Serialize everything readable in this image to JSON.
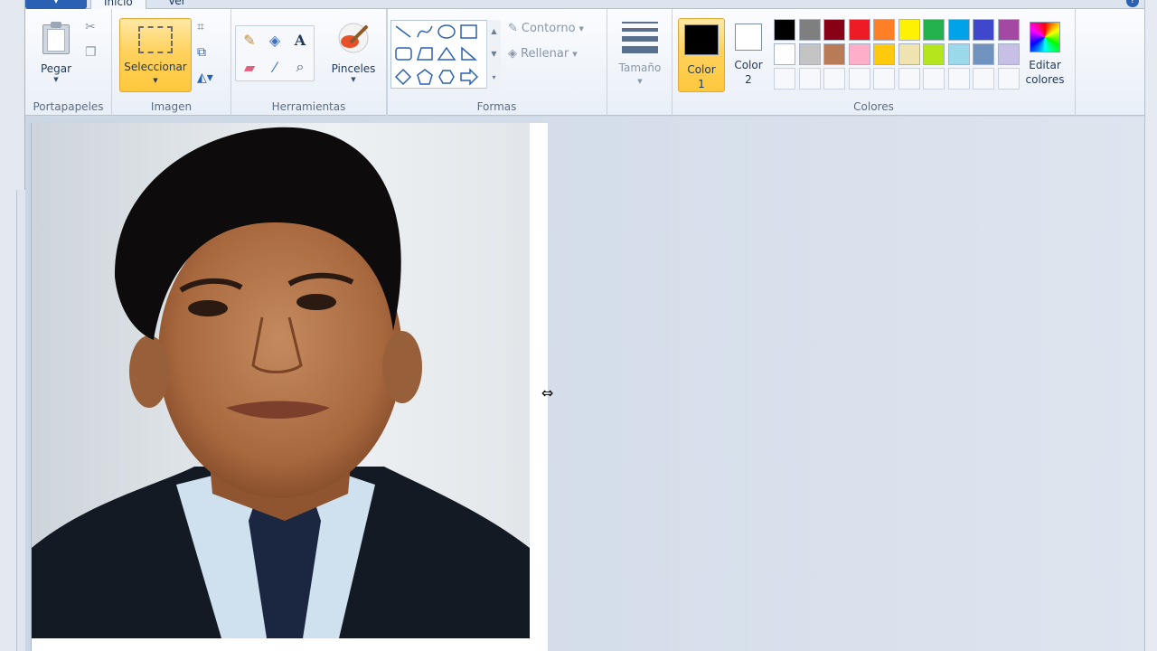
{
  "tabs": {
    "file_label": "",
    "home": "Inicio",
    "view": "Ver"
  },
  "clipboard": {
    "paste": "Pegar",
    "group": "Portapapeles"
  },
  "image": {
    "select": "Seleccionar",
    "group": "Imagen"
  },
  "tools": {
    "group": "Herramientas"
  },
  "brushes": {
    "label": "Pinceles"
  },
  "shapes": {
    "outline": "Contorno",
    "fill": "Rellenar",
    "group": "Formas"
  },
  "size": {
    "label": "Tamaño"
  },
  "colors": {
    "color1": "Color 1",
    "color2": "Color 2",
    "edit": "Editar colores",
    "group": "Colores",
    "color1_value": "#000000",
    "color2_value": "#ffffff",
    "palette_row1": [
      "#000000",
      "#7f7f7f",
      "#880015",
      "#ed1c24",
      "#ff7f27",
      "#fff200",
      "#22b14c",
      "#00a2e8",
      "#3f48cc",
      "#a349a4"
    ],
    "palette_row2": [
      "#ffffff",
      "#c3c3c3",
      "#b97a57",
      "#ffaec9",
      "#ffc90e",
      "#efe4b0",
      "#b5e61d",
      "#99d9ea",
      "#7092be",
      "#c8bfe7"
    ]
  }
}
